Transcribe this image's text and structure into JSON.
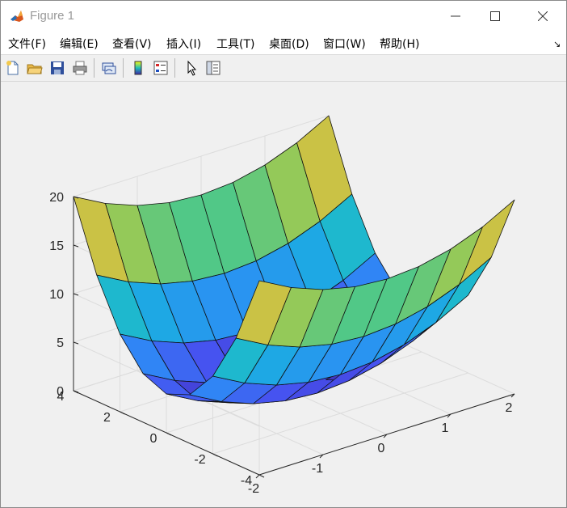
{
  "window": {
    "title": "Figure 1",
    "controls": {
      "minimize": "—",
      "maximize": "☐",
      "close": "✕"
    }
  },
  "menu": {
    "items": [
      {
        "label": "文件(F)"
      },
      {
        "label": "编辑(E)"
      },
      {
        "label": "查看(V)"
      },
      {
        "label": "插入(I)"
      },
      {
        "label": "工具(T)"
      },
      {
        "label": "桌面(D)"
      },
      {
        "label": "窗口(W)"
      },
      {
        "label": "帮助(H)"
      }
    ],
    "dock_icon": "↘"
  },
  "toolbar": {
    "buttons": [
      {
        "icon": "new-figure-icon"
      },
      {
        "icon": "open-file-icon"
      },
      {
        "icon": "save-icon"
      },
      {
        "icon": "print-icon"
      },
      {
        "icon": "link-plot-icon"
      },
      {
        "icon": "insert-colorbar-icon"
      },
      {
        "icon": "insert-legend-icon"
      },
      {
        "icon": "edit-plot-pointer-icon"
      },
      {
        "icon": "property-inspector-icon"
      }
    ]
  },
  "chart_data": {
    "type": "surface",
    "function": "z = x^2 + y^2",
    "x": [
      -2,
      -1.5,
      -1,
      -0.5,
      0,
      0.5,
      1,
      1.5,
      2
    ],
    "y": [
      -4,
      -3,
      -2,
      -1,
      0,
      1,
      2,
      3,
      4
    ],
    "xticks": [
      "-2",
      "-1",
      "0",
      "1",
      "2"
    ],
    "yticks": [
      "-4",
      "-2",
      "0",
      "2",
      "4"
    ],
    "zticks": [
      "0",
      "5",
      "10",
      "15",
      "20"
    ],
    "xlim": [
      -2,
      2
    ],
    "ylim": [
      -4,
      4
    ],
    "zlim": [
      0,
      20
    ],
    "colormap": "parula",
    "grid": true,
    "view": "3D default (az -37.5, el 30)"
  }
}
